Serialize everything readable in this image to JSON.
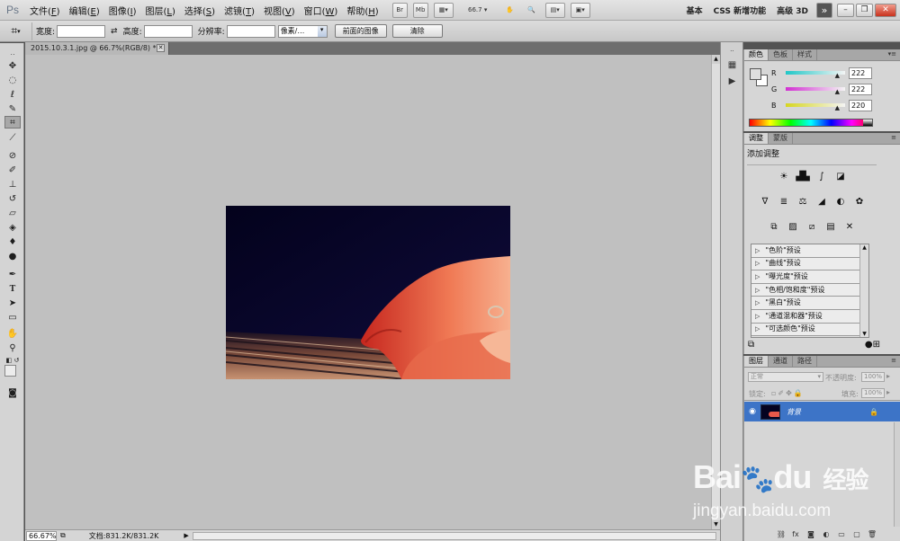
{
  "app": {
    "logo": "Ps"
  },
  "menu": [
    {
      "label": "文件(",
      "key": "F",
      "close": ")"
    },
    {
      "label": "编辑(",
      "key": "E",
      "close": ")"
    },
    {
      "label": "图像(",
      "key": "I",
      "close": ")"
    },
    {
      "label": "图层(",
      "key": "L",
      "close": ")"
    },
    {
      "label": "选择(",
      "key": "S",
      "close": ")"
    },
    {
      "label": "滤镜(",
      "key": "T",
      "close": ")"
    },
    {
      "label": "视图(",
      "key": "V",
      "close": ")"
    },
    {
      "label": "窗口(",
      "key": "W",
      "close": ")"
    },
    {
      "label": "帮助(",
      "key": "H",
      "close": ")"
    }
  ],
  "appbar": {
    "br_label": "Br",
    "mb_label": "Mb",
    "zoom_value": "66.7"
  },
  "workspaces": [
    "基本",
    "CSS 新增功能",
    "高级 3D"
  ],
  "workspace_more": "»",
  "window_controls": {
    "minimize": "–",
    "restore": "❐",
    "close": "✕"
  },
  "options": {
    "width_label": "宽度:",
    "swap_icon": "⇄",
    "height_label": "高度:",
    "resolution_label": "分辨率:",
    "unit_select": "像素/…",
    "front_image_btn": "前面的图像",
    "clear_btn": "清除"
  },
  "document": {
    "tab_title": "2015.10.3.1.jpg @ 66.7%(RGB/8) *",
    "zoom": "66.67%",
    "doc_info": "文档:831.2K/831.2K"
  },
  "color_panel": {
    "tabs": [
      "颜色",
      "色板",
      "样式"
    ],
    "channels": [
      {
        "name": "R",
        "value": "222",
        "color": "#1fc7c7"
      },
      {
        "name": "G",
        "value": "222",
        "color": "#d22fd2"
      },
      {
        "name": "B",
        "value": "220",
        "color": "#d6d61f"
      }
    ]
  },
  "adjust_panel": {
    "tabs": [
      "调整",
      "蒙版"
    ],
    "title": "添加调整",
    "icons_row1": [
      "☀",
      "▟▙",
      "∫",
      "◪"
    ],
    "icons_row2": [
      "∇",
      "≣",
      "⚖",
      "◢",
      "◐",
      "✿"
    ],
    "icons_row3": [
      "⧉",
      "▨",
      "⧄",
      "▤",
      "✕"
    ],
    "presets": [
      "\"色阶\"预设",
      "\"曲线\"预设",
      "\"曝光度\"预设",
      "\"色相/饱和度\"预设",
      "\"黑白\"预设",
      "\"通道混和器\"预设",
      "\"可选颜色\"预设"
    ]
  },
  "layers_panel": {
    "tabs": [
      "图层",
      "通道",
      "路径"
    ],
    "blend_mode": "正常",
    "opacity_label": "不透明度:",
    "opacity_value": "100%",
    "lock_label": "锁定:",
    "fill_label": "填充:",
    "fill_value": "100%",
    "layer_name": "背景"
  },
  "watermark": {
    "brand": "Bai",
    "brand2": "du",
    "cn": "经验",
    "url": "jingyan.baidu.com"
  }
}
